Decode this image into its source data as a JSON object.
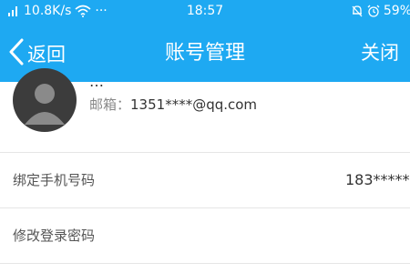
{
  "status_bar": {
    "network_speed": "10.8K/s",
    "more": "···",
    "time": "18:57",
    "battery": "59%"
  },
  "header": {
    "back_label": "返回",
    "title": "账号管理",
    "close_label": "关闭"
  },
  "profile": {
    "name": "…",
    "email_label": "邮箱：",
    "email": "1351****@qq.com"
  },
  "rows": [
    {
      "label": "绑定手机号码",
      "value": "183*****"
    },
    {
      "label": "修改登录密码",
      "value": ""
    }
  ],
  "colors": {
    "accent": "#1ea9f2",
    "divider": "#e6e6e6",
    "avatar_bg": "#3c3c3c"
  },
  "icons": [
    "signal-icon",
    "wifi-icon",
    "bell-off-icon",
    "alarm-icon",
    "back-chevron-icon",
    "default-avatar-icon"
  ]
}
